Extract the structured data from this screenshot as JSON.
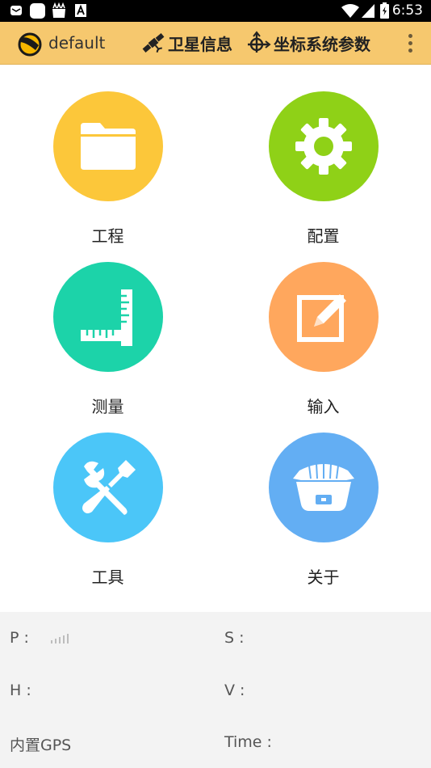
{
  "status_bar": {
    "time": "6:53",
    "icons": [
      "mail-icon",
      "app-icon",
      "store-icon",
      "text-icon",
      "wifi-icon",
      "signal-icon",
      "battery-icon"
    ]
  },
  "app_bar": {
    "title": "default",
    "action_satellite": "卫星信息",
    "action_coordinate": "坐标系统参数",
    "menu_icon": "more-vertical-icon"
  },
  "grid": {
    "items": [
      {
        "label": "工程",
        "icon": "folder-icon",
        "color": "#fcc73a"
      },
      {
        "label": "配置",
        "icon": "gear-icon",
        "color": "#8fd117"
      },
      {
        "label": "测量",
        "icon": "ruler-icon",
        "color": "#1cd3a9"
      },
      {
        "label": "输入",
        "icon": "edit-icon",
        "color": "#ffa75d"
      },
      {
        "label": "工具",
        "icon": "tools-icon",
        "color": "#4bc6f8"
      },
      {
        "label": "关于",
        "icon": "gnss-receiver-icon",
        "color": "#63aef3"
      }
    ]
  },
  "info": {
    "p_label": "P :",
    "s_label": "S :",
    "h_label": "H :",
    "v_label": "V :",
    "source": "内置GPS",
    "time_label": "Time :"
  },
  "colors": {
    "app_bar": "#f6c86e",
    "panel": "#f3f3f3"
  }
}
